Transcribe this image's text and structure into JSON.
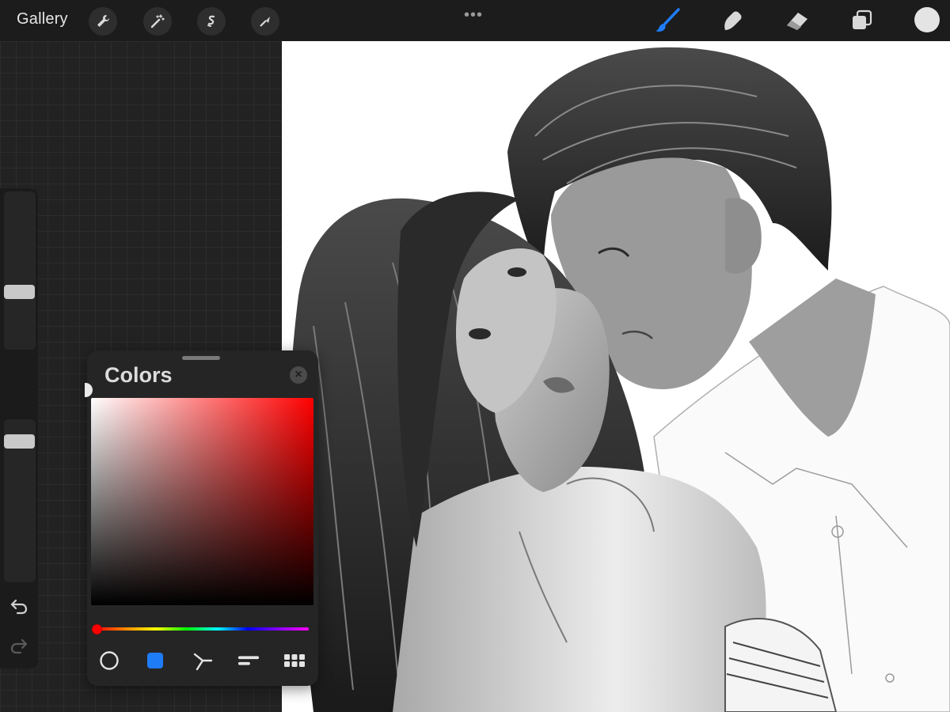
{
  "topbar": {
    "gallery_label": "Gallery",
    "more_dots": "•••",
    "left_tools": [
      "wrench-icon",
      "magic-wand-icon",
      "selection-icon",
      "transform-arrow-icon"
    ],
    "right_tools": [
      "brush-icon",
      "smudge-icon",
      "eraser-icon",
      "layers-icon"
    ],
    "active_tool": "brush",
    "current_color": "#e4e4e4",
    "accent": "#1f7cf7"
  },
  "sidebar": {
    "brush_size_level": 0.35,
    "opacity_level": 0.9
  },
  "colors_panel": {
    "title": "Colors",
    "close_glyph": "×",
    "hue": "#ff0000",
    "tabs": [
      "disc-icon",
      "classic-square-icon",
      "harmony-icon",
      "value-sliders-icon",
      "palettes-icon"
    ],
    "active_tab": 1
  }
}
